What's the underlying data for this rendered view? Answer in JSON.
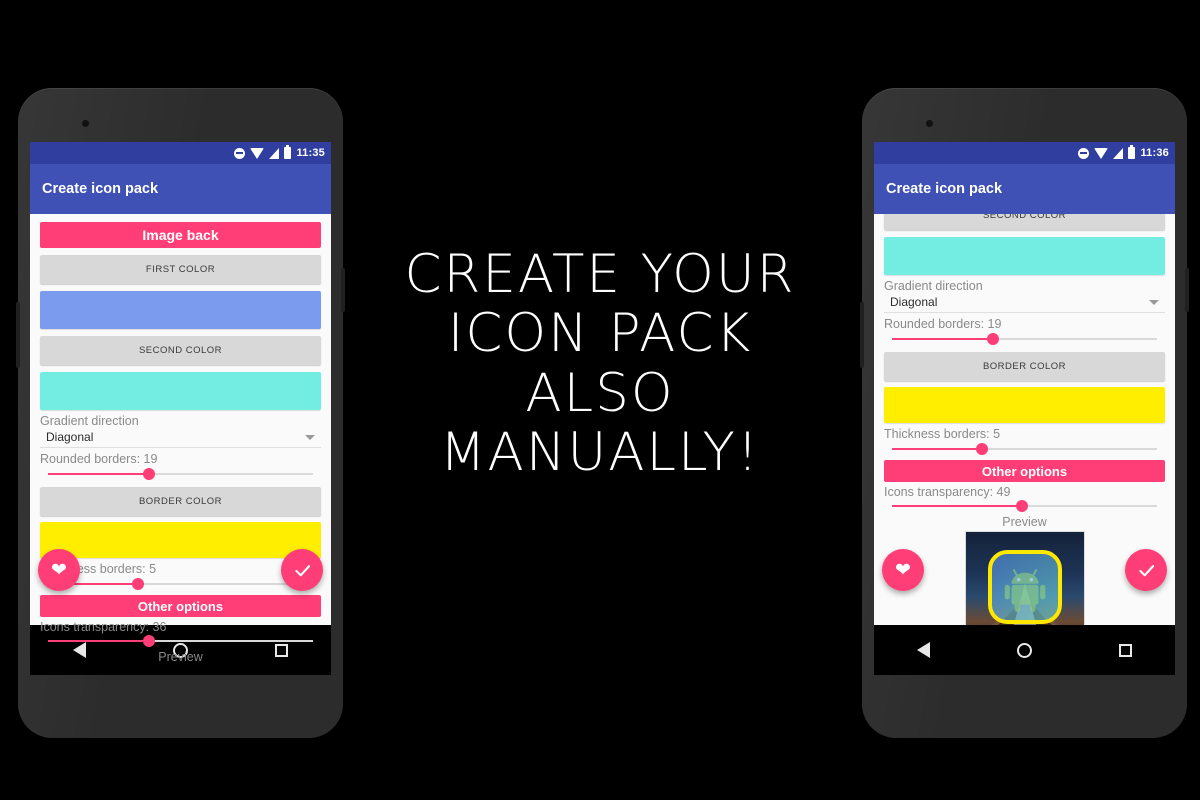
{
  "background_color": "#000000",
  "tagline": {
    "lines": [
      "Create your",
      "icon pack",
      "also",
      "manually!"
    ],
    "color": "#ffffff"
  },
  "theme": {
    "accent_pink": "#ff3d77",
    "appbar_indigo": "#3f51b5",
    "statusbar_indigo": "#303f9f",
    "button_grey": "#d8d8d8",
    "screen_background": "#fafafa"
  },
  "phone_left": {
    "status_bar": {
      "time": "11:35",
      "icons": [
        "dnd-icon",
        "wifi-icon",
        "signal-icon",
        "battery-icon"
      ]
    },
    "app_bar": {
      "title": "Create icon pack"
    },
    "section_header": "Image back",
    "first_color_button": "FIRST COLOR",
    "first_color_value": "#7b9bee",
    "second_color_button": "SECOND COLOR",
    "second_color_value": "#73ede2",
    "gradient_direction_label": "Gradient direction",
    "gradient_direction_value": "Diagonal",
    "rounded_borders_label": "Rounded borders: 19",
    "rounded_borders_value": 19,
    "rounded_borders_percent": 38,
    "border_color_button": "BORDER COLOR",
    "border_color_value": "#ffee00",
    "thickness_label": "Thickness borders: 5",
    "thickness_value": 5,
    "thickness_percent": 34,
    "other_options_header": "Other options",
    "transparency_label": "Icons transparency: 36",
    "transparency_value": 36,
    "transparency_percent": 38,
    "preview_label": "Preview",
    "fab_favorite": "favorite-heart-icon",
    "fab_confirm": "check-icon",
    "nav_bar": [
      "back-icon",
      "home-icon",
      "recents-icon"
    ]
  },
  "phone_right": {
    "status_bar": {
      "time": "11:36",
      "icons": [
        "dnd-icon",
        "wifi-icon",
        "signal-icon",
        "battery-icon"
      ]
    },
    "app_bar": {
      "title": "Create icon pack"
    },
    "second_color_button": "SECOND COLOR",
    "second_color_value": "#73ede2",
    "gradient_direction_label": "Gradient direction",
    "gradient_direction_value": "Diagonal",
    "rounded_borders_label": "Rounded borders: 19",
    "rounded_borders_value": 19,
    "rounded_borders_percent": 38,
    "border_color_button": "BORDER COLOR",
    "border_color_value": "#ffee00",
    "thickness_label": "Thickness borders: 5",
    "thickness_value": 5,
    "thickness_percent": 34,
    "other_options_header": "Other options",
    "transparency_label": "Icons transparency: 49",
    "transparency_value": 49,
    "transparency_percent": 49,
    "preview_label": "Preview",
    "fab_favorite": "favorite-heart-icon",
    "fab_confirm": "check-icon",
    "nav_bar": [
      "back-icon",
      "home-icon",
      "recents-icon"
    ]
  }
}
